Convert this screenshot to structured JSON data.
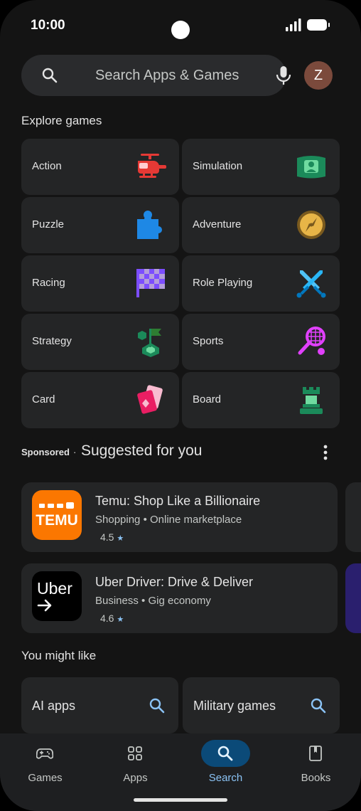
{
  "status": {
    "time": "10:00"
  },
  "search": {
    "placeholder": "Search Apps & Games",
    "avatar_letter": "Z"
  },
  "explore": {
    "title": "Explore games",
    "categories": [
      {
        "label": "Action",
        "icon": "helicopter-icon"
      },
      {
        "label": "Simulation",
        "icon": "simulation-icon"
      },
      {
        "label": "Puzzle",
        "icon": "puzzle-icon"
      },
      {
        "label": "Adventure",
        "icon": "compass-icon"
      },
      {
        "label": "Racing",
        "icon": "checkered-flag-icon"
      },
      {
        "label": "Role Playing",
        "icon": "crossed-swords-icon"
      },
      {
        "label": "Strategy",
        "icon": "strategy-flag-icon"
      },
      {
        "label": "Sports",
        "icon": "tennis-racket-icon"
      },
      {
        "label": "Card",
        "icon": "playing-cards-icon"
      },
      {
        "label": "Board",
        "icon": "chess-rook-icon"
      }
    ]
  },
  "suggested": {
    "sponsored_label": "Sponsored",
    "separator": "·",
    "title": "Suggested for you",
    "apps": [
      {
        "name": "Temu: Shop Like a Billionaire",
        "category": "Shopping",
        "tag": "Online marketplace",
        "rating": "4.5",
        "icon_text": "TEMU",
        "icon_color": "#fb7701"
      },
      {
        "name": "Uber Driver: Drive & Deliver",
        "category": "Business",
        "tag": "Gig economy",
        "rating": "4.6",
        "icon_text": "Uber",
        "icon_color": "#000000"
      }
    ]
  },
  "might_like": {
    "title": "You might like",
    "chips": [
      {
        "label": "AI apps"
      },
      {
        "label": "Military games"
      }
    ]
  },
  "nav": {
    "items": [
      {
        "label": "Games",
        "icon": "gamepad-icon",
        "active": false
      },
      {
        "label": "Apps",
        "icon": "apps-grid-icon",
        "active": false
      },
      {
        "label": "Search",
        "icon": "search-icon",
        "active": true
      },
      {
        "label": "Books",
        "icon": "book-icon",
        "active": false
      }
    ]
  },
  "colors": {
    "background": "#141414",
    "card": "#242526",
    "accent": "#8bc3f5",
    "active_pill": "#0b4a78",
    "star": "#8bc3f5"
  }
}
